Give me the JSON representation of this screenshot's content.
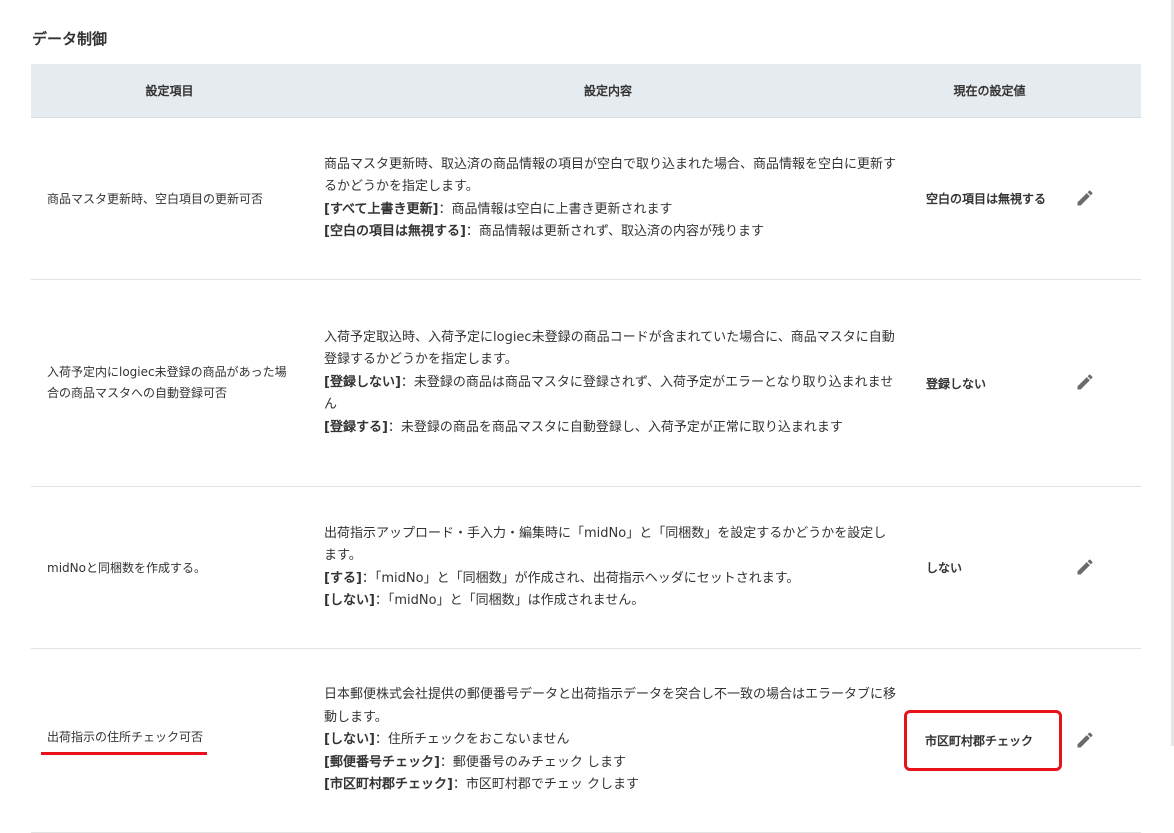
{
  "section": {
    "title": "データ制御"
  },
  "table": {
    "headers": [
      "設定項目",
      "設定内容",
      "現在の設定値"
    ],
    "rows": [
      {
        "name": "商品マスタ更新時、空白項目の更新可否",
        "intro": "商品マスタ更新時、取込済の商品情報の項目が空白で取り込まれた場合、商品情報を空白に更新するかどうかを指定します。",
        "options": [
          {
            "label": "[すべて上書き更新]",
            "text": "：商品情報は空白に上書き更新されます"
          },
          {
            "label": "[空白の項目は無視する]",
            "text": "：商品情報は更新されず、取込済の内容が残ります"
          }
        ],
        "value": "空白の項目は無視する"
      },
      {
        "name": "入荷予定内にlogiec未登録の商品があった場合の商品マスタへの自動登録可否",
        "intro": "入荷予定取込時、入荷予定にlogiec未登録の商品コードが含まれていた場合に、商品マスタに自動登録するかどうかを指定します。",
        "options": [
          {
            "label": "[登録しない]",
            "text": "：未登録の商品は商品マスタに登録されず、入荷予定がエラーとなり取り込まれません"
          },
          {
            "label": "[登録する]",
            "text": "：未登録の商品を商品マスタに自動登録し、入荷予定が正常に取り込まれます"
          }
        ],
        "value": "登録しない"
      },
      {
        "name": "midNoと同梱数を作成する。",
        "intro": "出荷指示アップロード・手入力・編集時に「midNo」と「同梱数」を設定するかどうかを設定します。",
        "options": [
          {
            "label": "[する]",
            "text": "：「midNo」と「同梱数」が作成され、出荷指示ヘッダにセットされます。"
          },
          {
            "label": "[しない]",
            "text": "：「midNo」と「同梱数」は作成されません。"
          }
        ],
        "value": "しない"
      },
      {
        "name": "出荷指示の住所チェック可否",
        "intro": "日本郵便株式会社提供の郵便番号データと出荷指示データを突合し不一致の場合はエラータブに移動します。",
        "options": [
          {
            "label": "[しない]",
            "text": "：住所チェックをおこないません"
          },
          {
            "label": "[郵便番号チェック]",
            "text": "：郵便番号のみチェック します"
          },
          {
            "label": "[市区町村郡チェック]",
            "text": "：市区町村郡でチェッ クします"
          }
        ],
        "value": "市区町村郡チェック"
      }
    ]
  },
  "icons": {
    "edit": "pencil-icon"
  },
  "colors": {
    "header_bg": "#e6ebef",
    "highlight": "#e8121b",
    "icon": "#6b6b6b"
  }
}
